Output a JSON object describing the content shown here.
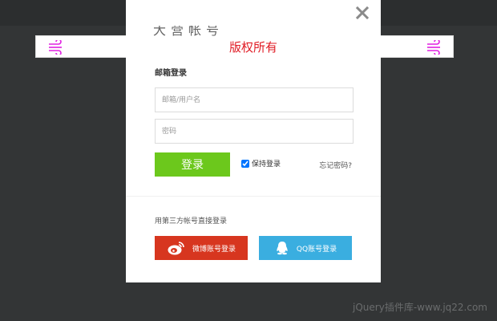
{
  "banner": {
    "left_icon": "wind-icon",
    "right_icon": "wind-icon"
  },
  "modal": {
    "title_partial": "大营帐号",
    "copyright": "版权所有",
    "email_section_label": "邮箱登录",
    "email_placeholder": "邮箱/用户名",
    "password_placeholder": "密码",
    "login_label": "登录",
    "remember_label": "保持登录",
    "remember_checked": true,
    "forgot_label": "忘记密码?",
    "third_party_label": "用第三方帐号直接登录",
    "weibo_label": "微博账号登录",
    "qq_label": "QQ账号登录",
    "close_icon": "close-icon"
  },
  "watermark": "jQuery插件库-www.jq22.com",
  "colors": {
    "background": "#333536",
    "login_green": "#6cc81c",
    "weibo_red": "#d7361f",
    "qq_blue": "#3aaee0",
    "copyright_red": "#e01b24",
    "banner_icon_magenta": "#e020e0"
  }
}
